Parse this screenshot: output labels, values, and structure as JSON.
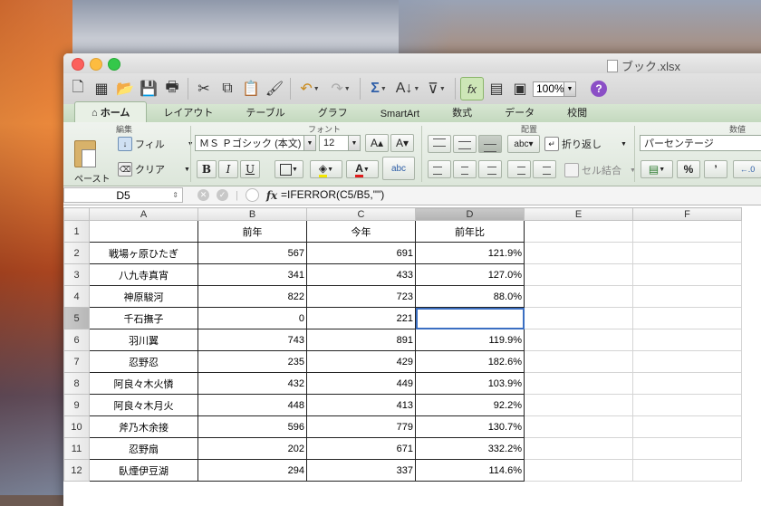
{
  "window": {
    "title": "ブック.xlsx"
  },
  "toolbar": {
    "zoom": "100%"
  },
  "tabs": [
    "ホーム",
    "レイアウト",
    "テーブル",
    "グラフ",
    "SmartArt",
    "数式",
    "データ",
    "校閲"
  ],
  "ribbon": {
    "groups": {
      "edit": "編集",
      "font": "フォント",
      "align": "配置",
      "number": "数値"
    },
    "paste_label": "ペースト",
    "fill_label": "フィル",
    "clear_label": "クリア",
    "font_name": "ＭＳ Ｐゴシック (本文)",
    "font_size": "12",
    "wrap_label": "折り返し",
    "merge_label": "セル結合",
    "number_format": "パーセンテージ",
    "percent_label": "%",
    "comma_label": "’"
  },
  "formula_bar": {
    "name_box": "D5",
    "fx": "fx",
    "formula": "=IFERROR(C5/B5,\"\")"
  },
  "columns": [
    "A",
    "B",
    "C",
    "D",
    "E",
    "F"
  ],
  "header_row": {
    "num": "1",
    "a": "",
    "b": "前年",
    "c": "今年",
    "d": "前年比"
  },
  "rows": [
    {
      "num": "2",
      "name": "戦場ヶ原ひたぎ",
      "prev": "567",
      "curr": "691",
      "ratio": "121.9%"
    },
    {
      "num": "3",
      "name": "八九寺真宵",
      "prev": "341",
      "curr": "433",
      "ratio": "127.0%"
    },
    {
      "num": "4",
      "name": "神原駿河",
      "prev": "822",
      "curr": "723",
      "ratio": "88.0%"
    },
    {
      "num": "5",
      "name": "千石撫子",
      "prev": "0",
      "curr": "221",
      "ratio": ""
    },
    {
      "num": "6",
      "name": "羽川翼",
      "prev": "743",
      "curr": "891",
      "ratio": "119.9%"
    },
    {
      "num": "7",
      "name": "忍野忍",
      "prev": "235",
      "curr": "429",
      "ratio": "182.6%"
    },
    {
      "num": "8",
      "name": "阿良々木火憐",
      "prev": "432",
      "curr": "449",
      "ratio": "103.9%"
    },
    {
      "num": "9",
      "name": "阿良々木月火",
      "prev": "448",
      "curr": "413",
      "ratio": "92.2%"
    },
    {
      "num": "10",
      "name": "斧乃木余接",
      "prev": "596",
      "curr": "779",
      "ratio": "130.7%"
    },
    {
      "num": "11",
      "name": "忍野扇",
      "prev": "202",
      "curr": "671",
      "ratio": "332.2%"
    },
    {
      "num": "12",
      "name": "臥煙伊豆湖",
      "prev": "294",
      "curr": "337",
      "ratio": "114.6%"
    }
  ],
  "colors": {
    "selection": "#3b6fc2",
    "tab_bar": "#c4d9bf"
  }
}
